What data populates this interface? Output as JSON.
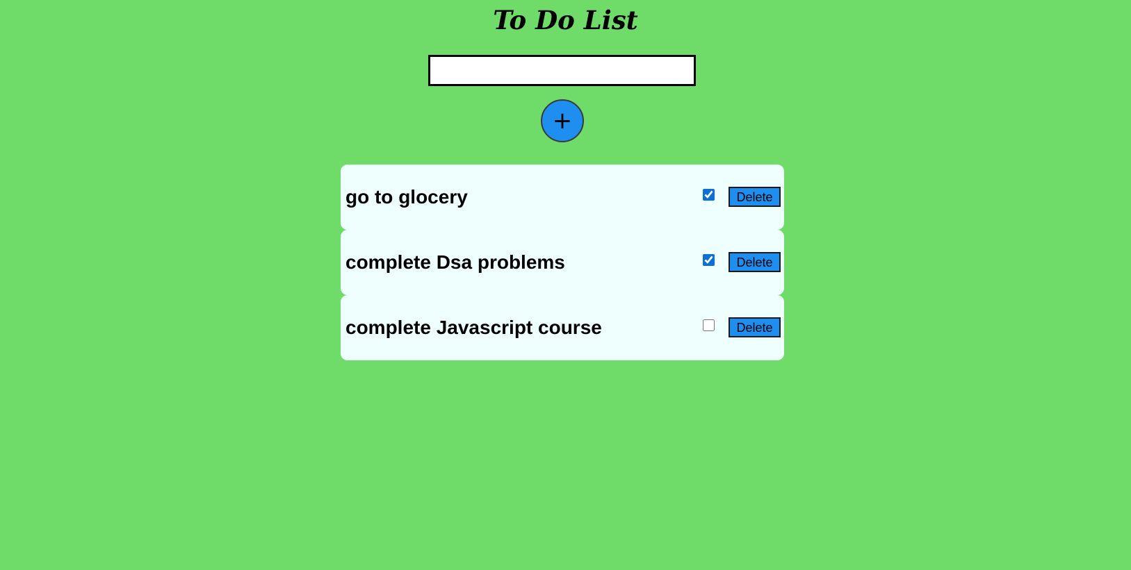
{
  "app": {
    "title": "To Do List"
  },
  "input": {
    "value": "",
    "placeholder": ""
  },
  "add_button": {
    "label": "+"
  },
  "tasks": [
    {
      "text": "go to glocery",
      "done": true,
      "delete_label": "Delete"
    },
    {
      "text": "complete Dsa problems",
      "done": true,
      "delete_label": "Delete"
    },
    {
      "text": "complete Javascript course",
      "done": false,
      "delete_label": "Delete"
    }
  ],
  "colors": {
    "background": "#6fdb69",
    "accent": "#1f8ef1",
    "card": "#eefffd"
  }
}
